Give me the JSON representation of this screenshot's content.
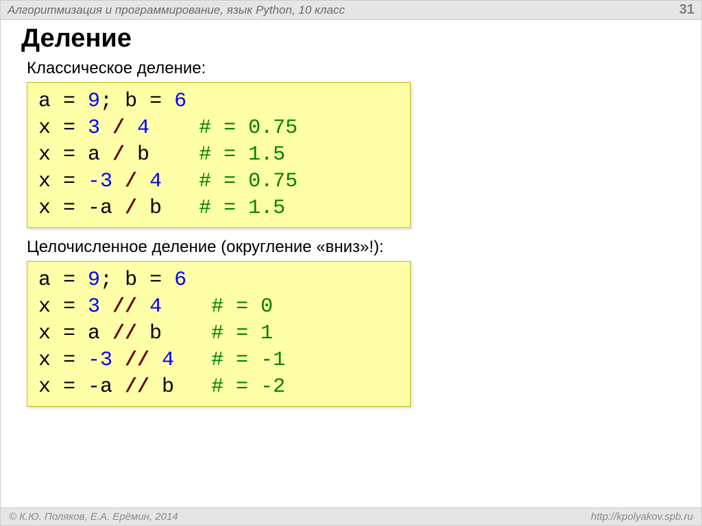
{
  "header": {
    "title": "Алгоритмизация и программирование, язык Python, 10 класс",
    "page": "31"
  },
  "title": "Деление",
  "sections": [
    {
      "subtitle": "Классическое деление:",
      "code": [
        [
          {
            "t": "a ",
            "c": "tok-var"
          },
          {
            "t": "=",
            "c": "tok-op"
          },
          {
            "t": " 9",
            "c": "tok-num"
          },
          {
            "t": "; ",
            "c": "tok-op"
          },
          {
            "t": "b ",
            "c": "tok-var"
          },
          {
            "t": "=",
            "c": "tok-op"
          },
          {
            "t": " 6",
            "c": "tok-num"
          }
        ],
        [
          {
            "t": "x ",
            "c": "tok-var"
          },
          {
            "t": "=",
            "c": "tok-op"
          },
          {
            "t": " 3 ",
            "c": "tok-num"
          },
          {
            "t": "/",
            "c": "tok-div"
          },
          {
            "t": " 4    ",
            "c": "tok-num"
          },
          {
            "t": "# = 0.75",
            "c": "tok-cmt"
          }
        ],
        [
          {
            "t": "x ",
            "c": "tok-var"
          },
          {
            "t": "= a ",
            "c": "tok-op"
          },
          {
            "t": "/",
            "c": "tok-div"
          },
          {
            "t": " b    ",
            "c": "tok-op"
          },
          {
            "t": "# = 1.5",
            "c": "tok-cmt"
          }
        ],
        [
          {
            "t": "x ",
            "c": "tok-var"
          },
          {
            "t": "=",
            "c": "tok-op"
          },
          {
            "t": " -3 ",
            "c": "tok-num"
          },
          {
            "t": "/",
            "c": "tok-div"
          },
          {
            "t": " 4   ",
            "c": "tok-num"
          },
          {
            "t": "# = 0.75",
            "c": "tok-cmt"
          }
        ],
        [
          {
            "t": "x ",
            "c": "tok-var"
          },
          {
            "t": "= -a ",
            "c": "tok-op"
          },
          {
            "t": "/",
            "c": "tok-div"
          },
          {
            "t": " b   ",
            "c": "tok-op"
          },
          {
            "t": "# = 1.5",
            "c": "tok-cmt"
          }
        ]
      ]
    },
    {
      "subtitle": "Целочисленное деление (округление «вниз»!):",
      "code": [
        [
          {
            "t": "a ",
            "c": "tok-var"
          },
          {
            "t": "=",
            "c": "tok-op"
          },
          {
            "t": " 9",
            "c": "tok-num"
          },
          {
            "t": "; ",
            "c": "tok-op"
          },
          {
            "t": "b ",
            "c": "tok-var"
          },
          {
            "t": "=",
            "c": "tok-op"
          },
          {
            "t": " 6",
            "c": "tok-num"
          }
        ],
        [
          {
            "t": "x ",
            "c": "tok-var"
          },
          {
            "t": "=",
            "c": "tok-op"
          },
          {
            "t": " 3 ",
            "c": "tok-num"
          },
          {
            "t": "//",
            "c": "tok-div"
          },
          {
            "t": " 4    ",
            "c": "tok-num"
          },
          {
            "t": "# = 0",
            "c": "tok-cmt"
          }
        ],
        [
          {
            "t": "x ",
            "c": "tok-var"
          },
          {
            "t": "= a ",
            "c": "tok-op"
          },
          {
            "t": "//",
            "c": "tok-div"
          },
          {
            "t": " b    ",
            "c": "tok-op"
          },
          {
            "t": "# = 1",
            "c": "tok-cmt"
          }
        ],
        [
          {
            "t": "x ",
            "c": "tok-var"
          },
          {
            "t": "=",
            "c": "tok-op"
          },
          {
            "t": " -3 ",
            "c": "tok-num"
          },
          {
            "t": "//",
            "c": "tok-div"
          },
          {
            "t": " 4   ",
            "c": "tok-num"
          },
          {
            "t": "# = -1",
            "c": "tok-cmt"
          }
        ],
        [
          {
            "t": "x ",
            "c": "tok-var"
          },
          {
            "t": "= -a ",
            "c": "tok-op"
          },
          {
            "t": "//",
            "c": "tok-div"
          },
          {
            "t": " b   ",
            "c": "tok-op"
          },
          {
            "t": "# = -2",
            "c": "tok-cmt"
          }
        ]
      ]
    }
  ],
  "footer": {
    "left": "© К.Ю. Поляков, Е.А. Ерёмин, 2014",
    "right": "http://kpolyakov.spb.ru"
  }
}
